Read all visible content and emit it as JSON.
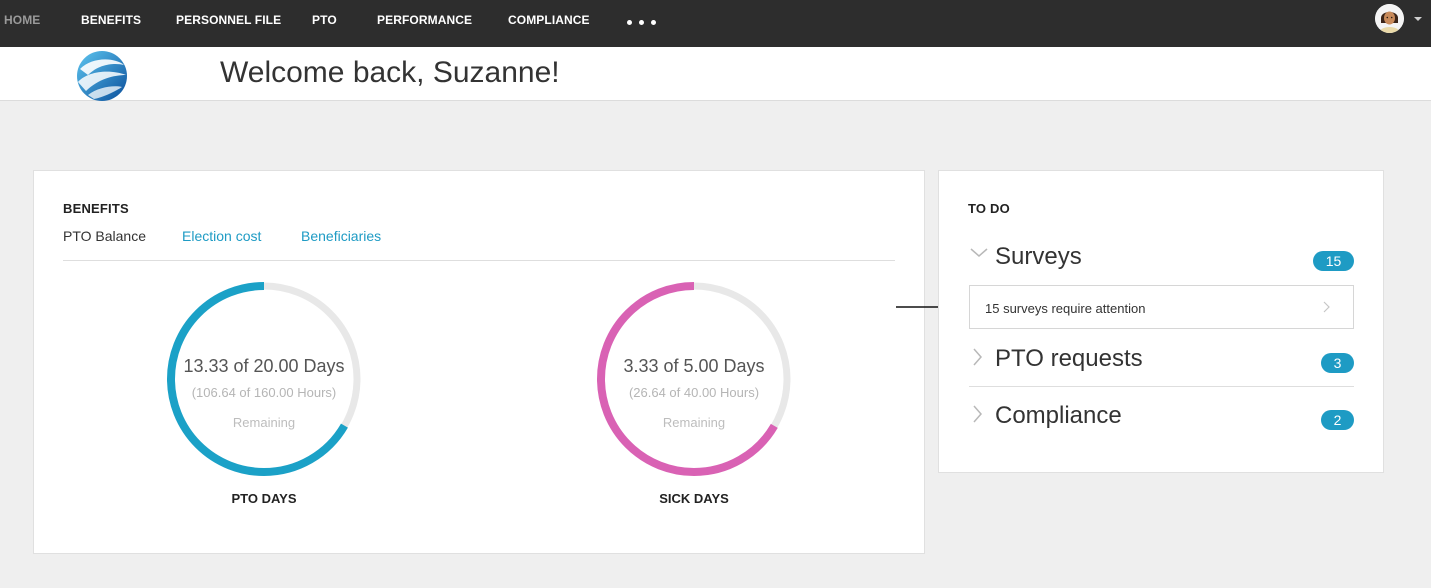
{
  "nav": {
    "items": [
      {
        "label": "HOME",
        "active": true
      },
      {
        "label": "BENEFITS",
        "active": false
      },
      {
        "label": "PERSONNEL FILE",
        "active": false
      },
      {
        "label": "PTO",
        "active": false
      },
      {
        "label": "PERFORMANCE",
        "active": false
      },
      {
        "label": "COMPLIANCE",
        "active": false
      }
    ],
    "more_icon": "ellipsis-icon",
    "avatar_icon": "user-avatar-icon",
    "dropdown_icon": "caret-down-icon"
  },
  "header": {
    "welcome": "Welcome back, Suzanne!",
    "logo_icon": "globe-logo-icon"
  },
  "benefits": {
    "title": "BENEFITS",
    "tabs": [
      {
        "label": "PTO Balance",
        "selected": true
      },
      {
        "label": "Election cost",
        "selected": false
      },
      {
        "label": "Beneficiaries",
        "selected": false
      }
    ],
    "gauges": [
      {
        "main": "13.33 of 20.00 Days",
        "sub": "(106.64 of 160.00 Hours)",
        "remaining": "Remaining",
        "label": "PTO DAYS",
        "fraction": 0.6665,
        "color": "#1ba1c7"
      },
      {
        "main": "3.33 of 5.00 Days",
        "sub": "(26.64 of 40.00 Hours)",
        "remaining": "Remaining",
        "label": "SICK DAYS",
        "fraction": 0.666,
        "color": "#d962b4"
      }
    ],
    "track_color": "#e8e8e8"
  },
  "todo": {
    "title": "TO DO",
    "sections": [
      {
        "label": "Surveys",
        "count": "15",
        "expanded": true
      },
      {
        "label": "PTO requests",
        "count": "3",
        "expanded": false
      },
      {
        "label": "Compliance",
        "count": "2",
        "expanded": false
      }
    ],
    "survey_item": "15 surveys require attention",
    "accent": "#1e9bc4"
  }
}
